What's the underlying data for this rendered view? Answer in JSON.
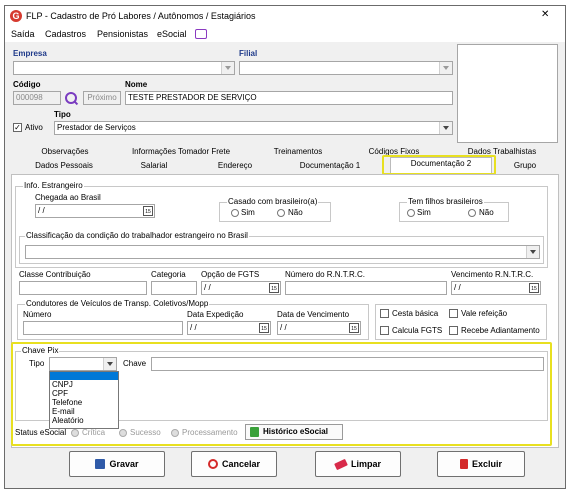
{
  "window": {
    "title": "FLP - Cadastro de Pró Labores / Autônomos / Estagiários",
    "close_glyph": "✕"
  },
  "menu": {
    "items": [
      "Saída",
      "Cadastros",
      "Pensionistas",
      "eSocial"
    ]
  },
  "header": {
    "empresa_label": "Empresa",
    "empresa_value": "",
    "filial_label": "Filial",
    "filial_value": "",
    "codigo_label": "Código",
    "codigo_value": "000098",
    "proximo_label": "Próximo",
    "nome_label": "Nome",
    "nome_value": "TESTE PRESTADOR DE SERVIÇO",
    "tipo_label": "Tipo",
    "tipo_value": "Prestador de Serviços",
    "ativo_label": "Ativo",
    "ativo_checked": true
  },
  "tabs": {
    "row1": [
      "Observações",
      "Informações Tomador Frete",
      "Treinamentos",
      "Códigos Fixos",
      "Dados Trabalhistas"
    ],
    "row2": [
      "Dados Pessoais",
      "Salarial",
      "Endereço",
      "Documentação 1",
      "Documentação 2",
      "Grupo"
    ],
    "active": "Documentação 2"
  },
  "estrangeiro": {
    "title": "Info. Estrangeiro",
    "chegada_label": "Chegada ao Brasil",
    "chegada_value": "/ /",
    "casado_title": "Casado com brasileiro(a)",
    "filhos_title": "Tem filhos brasileiros",
    "sim": "Sim",
    "nao": "Não",
    "classificacao_title": "Classificação da condição do trabalhador estrangeiro no Brasil"
  },
  "fields": {
    "classe_label": "Classe Contribuição",
    "categoria_label": "Categoria",
    "opcao_fgts_label": "Opção de FGTS",
    "opcao_fgts_value": "/ /",
    "rntrc_label": "Número do R.N.T.R.C.",
    "vencimento_rntrc_label": "Vencimento R.N.T.R.C.",
    "vencimento_rntrc_value": "/ /"
  },
  "condutores": {
    "title": "Condutores de Veículos de Transp. Coletivos/Mopp",
    "numero_label": "Número",
    "data_expedicao_label": "Data Expedição",
    "data_expedicao_value": "/ /",
    "data_vencimento_label": "Data de Vencimento",
    "data_vencimento_value": "/ /"
  },
  "beneficios": {
    "cesta_basica": "Cesta básica",
    "vale_refeicao": "Vale refeição",
    "calcula_fgts": "Calcula FGTS",
    "recebe_adiantamento": "Recebe Adiantamento"
  },
  "pix": {
    "title": "Chave Pix",
    "tipo_label": "Tipo",
    "chave_label": "Chave",
    "options": [
      "",
      "CNPJ",
      "CPF",
      "Telefone",
      "E-mail",
      "Aleatório"
    ]
  },
  "status": {
    "label": "Status eSocial",
    "options": [
      "Crítica",
      "Sucesso",
      "Processamento"
    ],
    "historico_label": "Histórico eSocial"
  },
  "buttons": {
    "gravar": "Gravar",
    "cancelar": "Cancelar",
    "limpar": "Limpar",
    "excluir": "Excluir"
  },
  "colors": {
    "highlight": "#e8e020",
    "selected_item": "#0078d7"
  }
}
